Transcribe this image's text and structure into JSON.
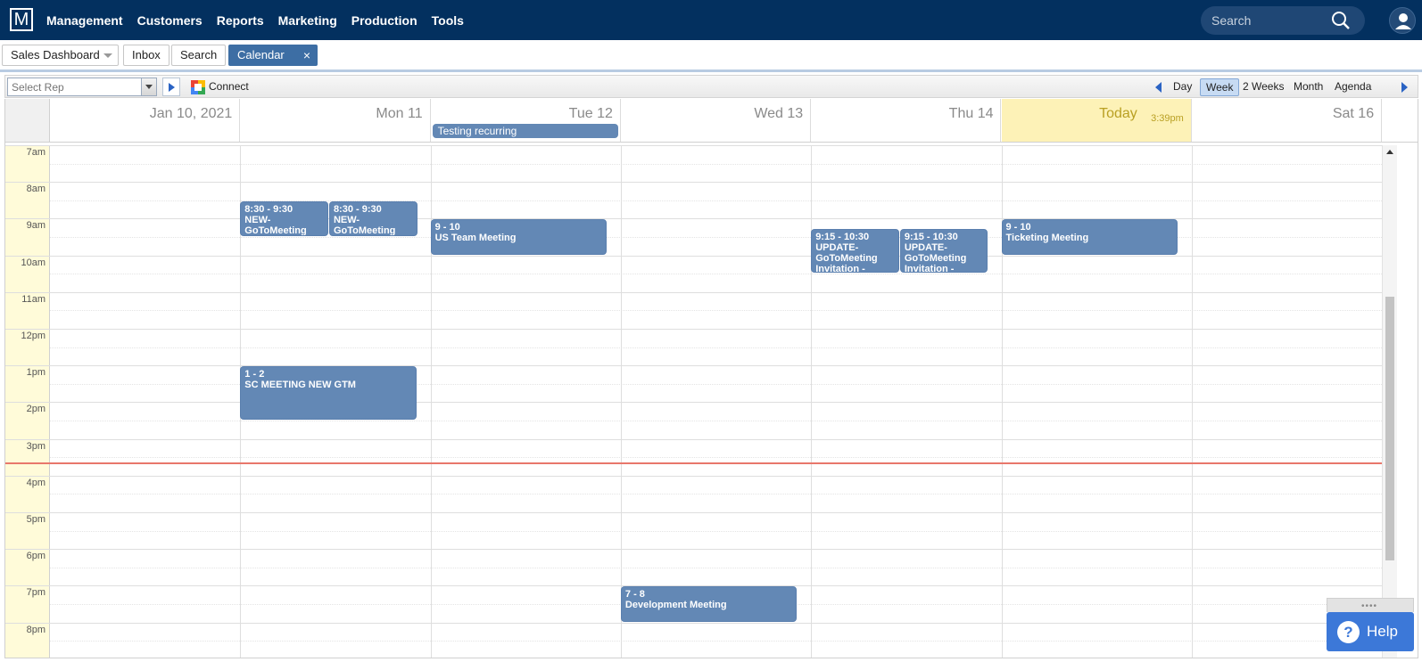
{
  "app": {
    "logo_letter": "M",
    "nav": [
      "Management",
      "Customers",
      "Reports",
      "Marketing",
      "Production",
      "Tools"
    ],
    "search_placeholder": "Search"
  },
  "tabs": {
    "dashboard": "Sales Dashboard",
    "inbox": "Inbox",
    "search": "Search",
    "calendar": "Calendar",
    "close": "×"
  },
  "toolbar": {
    "rep_placeholder": "Select Rep",
    "connect": "Connect",
    "views": [
      "Day",
      "Week",
      "2 Weeks",
      "Month",
      "Agenda"
    ],
    "active_view": "Week"
  },
  "days": [
    {
      "label": "Jan 10, 2021"
    },
    {
      "label": "Mon 11"
    },
    {
      "label": "Tue 12"
    },
    {
      "label": "Wed 13"
    },
    {
      "label": "Thu 14"
    },
    {
      "label": "Today",
      "time": "3:39pm",
      "today": true
    },
    {
      "label": "Sat 16"
    }
  ],
  "hours": [
    "7am",
    "8am",
    "9am",
    "10am",
    "11am",
    "12pm",
    "1pm",
    "2pm",
    "3pm",
    "4pm",
    "5pm",
    "6pm",
    "7pm",
    "8pm"
  ],
  "allday_events": [
    {
      "day": 2,
      "title": "Testing recurring"
    }
  ],
  "events": [
    {
      "day": 1,
      "col": 0,
      "start": 8.5,
      "end": 9.5,
      "time": "8:30 - 9:30",
      "title": "NEW-GoToMeeting Invitation - Testing"
    },
    {
      "day": 1,
      "col": 1,
      "start": 8.5,
      "end": 9.5,
      "time": "8:30 - 9:30",
      "title": "NEW-GoToMeeting Invitation - Testing"
    },
    {
      "day": 2,
      "col": 0,
      "start": 9,
      "end": 10,
      "time": "9 - 10",
      "title": "US Team Meeting"
    },
    {
      "day": 4,
      "col": 0,
      "start": 9.25,
      "end": 10.5,
      "time": "9:15 - 10:30",
      "title": "UPDATE-GoToMeeting Invitation - Customer"
    },
    {
      "day": 4,
      "col": 1,
      "start": 9.25,
      "end": 10.5,
      "time": "9:15 - 10:30",
      "title": "UPDATE-GoToMeeting Invitation - Customer"
    },
    {
      "day": 5,
      "col": 0,
      "start": 9,
      "end": 10,
      "time": "9 - 10",
      "title": "Ticketing Meeting"
    },
    {
      "day": 1,
      "col": 0,
      "start": 13,
      "end": 14.5,
      "time": "1 - 2",
      "title": "SC MEETING NEW GTM",
      "wide": true
    },
    {
      "day": 3,
      "col": 0,
      "start": 19,
      "end": 20,
      "time": "7 - 8",
      "title": "Development Meeting"
    }
  ],
  "now_hour": 15.65,
  "help": {
    "label": "Help",
    "icon": "?"
  },
  "colors": {
    "nav_bg": "#03305f",
    "event_bg": "#6388b5",
    "today_bg": "#fdf2b7",
    "now_line": "#e8776b"
  }
}
